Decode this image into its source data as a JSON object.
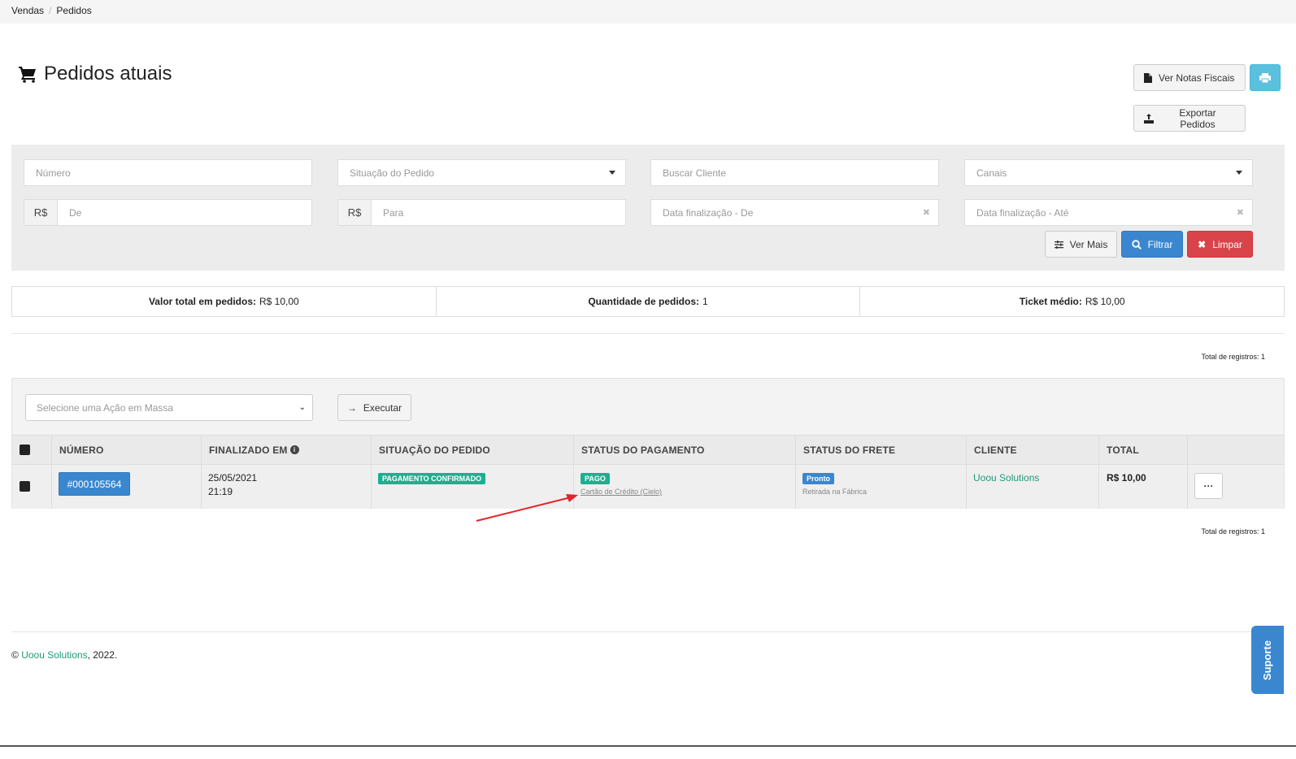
{
  "breadcrumb": {
    "item1": "Vendas",
    "item2": "Pedidos"
  },
  "page": {
    "title": "Pedidos atuais"
  },
  "header_buttons": {
    "notas": "Ver Notas Fiscais",
    "export": "Exportar Pedidos"
  },
  "filters": {
    "numero_placeholder": "Número",
    "situacao_placeholder": "Situação do Pedido",
    "cliente_placeholder": "Buscar Cliente",
    "canais_placeholder": "Canais",
    "currency": "R$",
    "de_placeholder": "De",
    "para_placeholder": "Para",
    "data_de_placeholder": "Data finalização - De",
    "data_ate_placeholder": "Data finalização - Até",
    "ver_mais": "Ver Mais",
    "filtrar": "Filtrar",
    "limpar": "Limpar"
  },
  "summary": {
    "valor_label": "Valor total em pedidos:",
    "valor": "R$ 10,00",
    "qtd_label": "Quantidade de pedidos:",
    "qtd": "1",
    "ticket_label": "Ticket médio:",
    "ticket": "R$ 10,00"
  },
  "total_registros": "Total de registros: 1",
  "mass_action": {
    "placeholder": "Selecione uma Ação em Massa",
    "execute": "Executar"
  },
  "table": {
    "headers": {
      "numero": "NÚMERO",
      "finalizado": "FINALIZADO EM",
      "situacao": "SITUAÇÃO DO PEDIDO",
      "pagamento": "STATUS DO PAGAMENTO",
      "frete": "STATUS DO FRETE",
      "cliente": "CLIENTE",
      "total": "TOTAL"
    },
    "rows": [
      {
        "numero": "#000105564",
        "data": "25/05/2021",
        "hora": "21:19",
        "situacao": "PAGAMENTO CONFIRMADO",
        "pagamento": "PAGO",
        "pagamento_metodo": "Cartão de Crédito (Cielo)",
        "frete": "Pronto",
        "frete_detalhe": "Retirada na Fábrica",
        "cliente": "Uoou Solutions",
        "total": "R$ 10,00",
        "actions": "···"
      }
    ]
  },
  "footer": {
    "copyright": "©",
    "company": "Uoou Solutions",
    "year": ", 2022."
  },
  "support": {
    "label": "Suporte"
  },
  "colors": {
    "primary": "#3a87cf",
    "info": "#5bc0de",
    "danger": "#d9434a",
    "success": "#1bb08f",
    "annotation": "#e5232a"
  },
  "icons": {
    "title": "cart-icon",
    "print": "print-icon",
    "search": "search-icon",
    "clear": "times-icon",
    "sliders": "sliders-icon",
    "arrow": "arrow-right-icon",
    "info": "info-icon",
    "file": "file-icon",
    "upload": "upload-icon"
  }
}
